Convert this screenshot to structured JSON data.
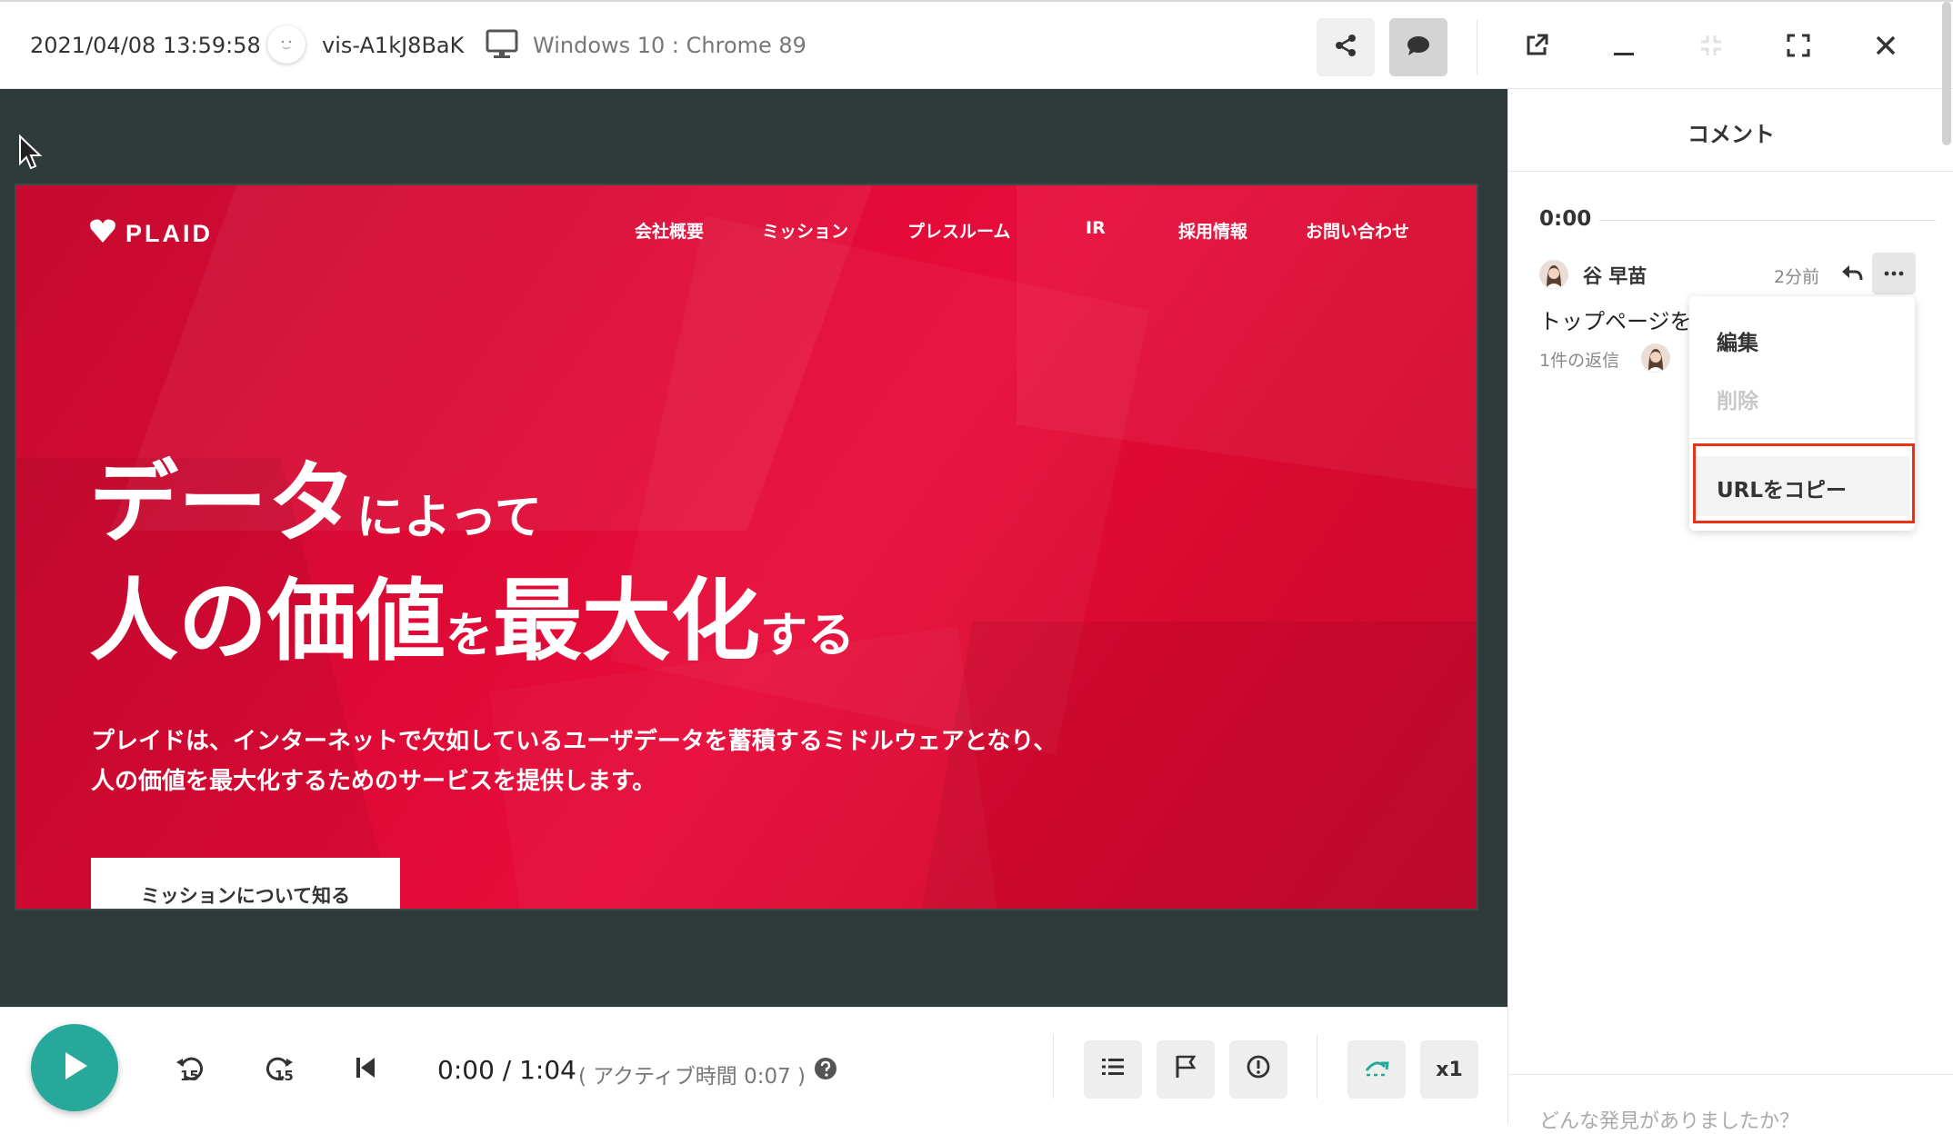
{
  "header": {
    "datetime": "2021/04/08 13:59:58",
    "visitor_id": "vis-A1kJ8BaK",
    "environment": "Windows 10 : Chrome 89"
  },
  "site": {
    "logo_text": "PLAID",
    "nav": [
      "会社概要",
      "ミッション",
      "プレスルーム",
      "IR",
      "採用情報",
      "お問い合わせ"
    ],
    "hero_line1_big": "データ",
    "hero_line1_small": "によって",
    "hero_line2_big_a": "人の価値",
    "hero_line2_small_a": "を",
    "hero_line2_big_b": "最大化",
    "hero_line2_small_b": "する",
    "description_line1": "プレイドは、インターネットで欠如しているユーザデータを蓄積するミドルウェアとなり、",
    "description_line2": "人の価値を最大化するためのサービスを提供します。",
    "cta_label": "ミッションについて知る"
  },
  "player": {
    "time_display": "0:00 / 1:04",
    "active_time": "( アクティブ時間 0:07 )",
    "rewind_label": "15",
    "forward_label": "15",
    "speed_label": "x1"
  },
  "panel": {
    "title": "コメント",
    "timestamp": "0:00",
    "comment": {
      "author": "谷 早苗",
      "ago": "2分前",
      "text": "トップページを",
      "replies": "1件の返信"
    },
    "menu": {
      "edit": "編集",
      "delete": "削除",
      "copy_url": "URLをコピー"
    },
    "input_placeholder": "どんな発見がありましたか？"
  },
  "colors": {
    "accent_teal": "#26a99a",
    "stage_bg": "#2f3b3b",
    "site_red": "#e00b37",
    "highlight_red": "#e8331a"
  }
}
